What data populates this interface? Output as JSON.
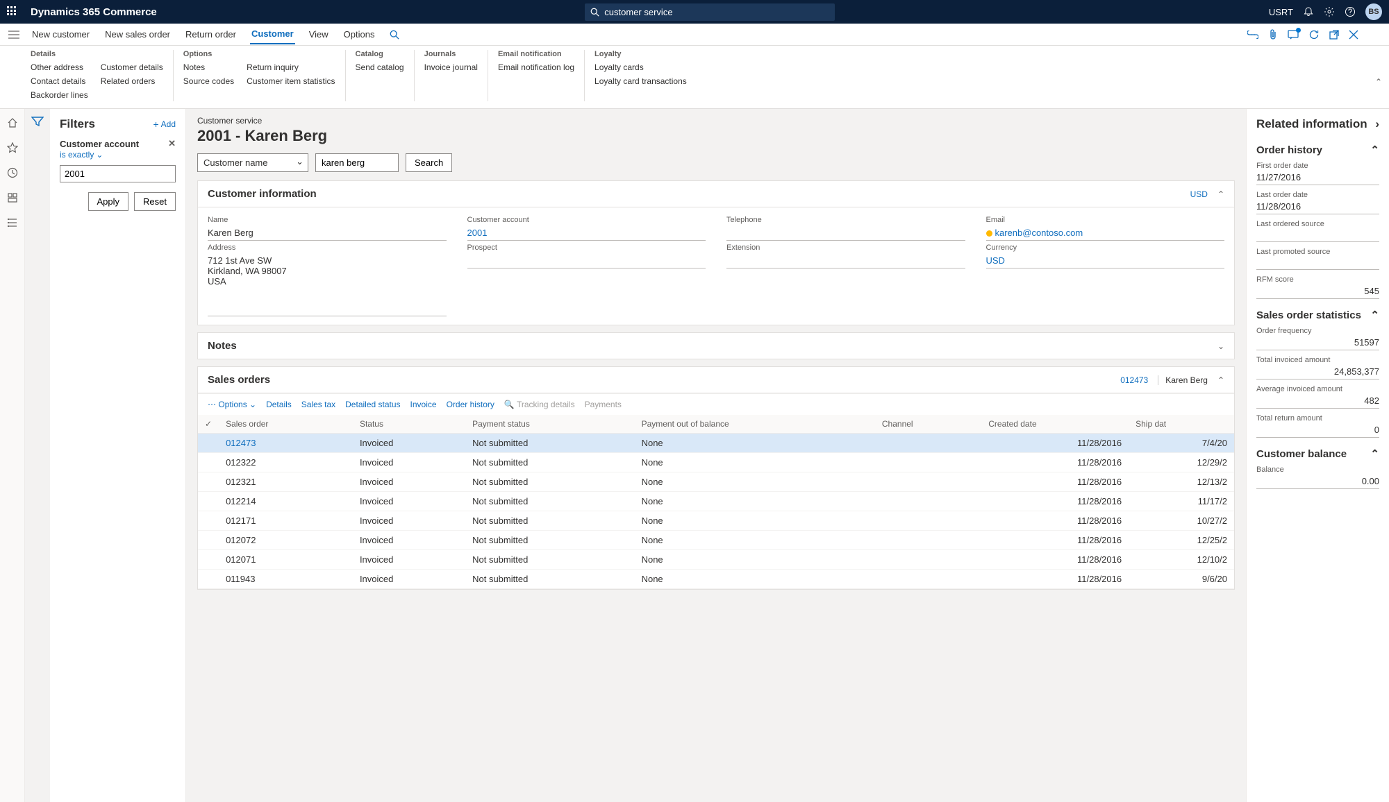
{
  "app": {
    "title": "Dynamics 365 Commerce",
    "search_value": "customer service",
    "company": "USRT",
    "avatar_initials": "BS"
  },
  "action_bar": {
    "items": [
      "New customer",
      "New sales order",
      "Return order",
      "Customer",
      "View",
      "Options"
    ]
  },
  "ribbon": {
    "groups": [
      {
        "title": "Details",
        "cols": [
          [
            "Other address",
            "Contact details",
            "Backorder lines"
          ],
          [
            "Customer details",
            "Related orders"
          ]
        ]
      },
      {
        "title": "Options",
        "cols": [
          [
            "Notes",
            "Source codes"
          ],
          [
            "Return inquiry",
            "Customer item statistics"
          ]
        ]
      },
      {
        "title": "Catalog",
        "cols": [
          [
            "Send catalog"
          ]
        ]
      },
      {
        "title": "Journals",
        "cols": [
          [
            "Invoice journal"
          ]
        ]
      },
      {
        "title": "Email notification",
        "cols": [
          [
            "Email notification log"
          ]
        ]
      },
      {
        "title": "Loyalty",
        "cols": [
          [
            "Loyalty cards",
            "Loyalty card transactions"
          ]
        ]
      }
    ]
  },
  "filters": {
    "title": "Filters",
    "add": "Add",
    "field_label": "Customer account",
    "operator": "is exactly",
    "value": "2001",
    "apply": "Apply",
    "reset": "Reset"
  },
  "page": {
    "breadcrumb": "Customer service",
    "title": "2001 - Karen Berg",
    "search_by": "Customer name",
    "search_value": "karen berg",
    "search_btn": "Search"
  },
  "customer_info": {
    "title": "Customer information",
    "currency_badge": "USD",
    "fields": {
      "name_label": "Name",
      "name": "Karen Berg",
      "account_label": "Customer account",
      "account": "2001",
      "telephone_label": "Telephone",
      "telephone": "",
      "email_label": "Email",
      "email": "karenb@contoso.com",
      "address_label": "Address",
      "address_line1": "712 1st Ave SW",
      "address_line2": "Kirkland, WA 98007",
      "address_line3": "USA",
      "prospect_label": "Prospect",
      "prospect": "",
      "extension_label": "Extension",
      "extension": "",
      "currency_label": "Currency",
      "currency": "USD"
    }
  },
  "notes": {
    "title": "Notes"
  },
  "sales_orders": {
    "title": "Sales orders",
    "current_id": "012473",
    "current_name": "Karen Berg",
    "toolbar": {
      "options": "Options",
      "details": "Details",
      "sales_tax": "Sales tax",
      "detailed_status": "Detailed status",
      "invoice": "Invoice",
      "order_history": "Order history",
      "tracking": "Tracking details",
      "payments": "Payments"
    },
    "columns": [
      "Sales order",
      "Status",
      "Payment status",
      "Payment out of balance",
      "Channel",
      "Created date",
      "Ship dat"
    ],
    "rows": [
      {
        "id": "012473",
        "status": "Invoiced",
        "pay": "Not submitted",
        "oob": "None",
        "channel": "",
        "created": "11/28/2016",
        "ship": "7/4/20"
      },
      {
        "id": "012322",
        "status": "Invoiced",
        "pay": "Not submitted",
        "oob": "None",
        "channel": "",
        "created": "11/28/2016",
        "ship": "12/29/2"
      },
      {
        "id": "012321",
        "status": "Invoiced",
        "pay": "Not submitted",
        "oob": "None",
        "channel": "",
        "created": "11/28/2016",
        "ship": "12/13/2"
      },
      {
        "id": "012214",
        "status": "Invoiced",
        "pay": "Not submitted",
        "oob": "None",
        "channel": "",
        "created": "11/28/2016",
        "ship": "11/17/2"
      },
      {
        "id": "012171",
        "status": "Invoiced",
        "pay": "Not submitted",
        "oob": "None",
        "channel": "",
        "created": "11/28/2016",
        "ship": "10/27/2"
      },
      {
        "id": "012072",
        "status": "Invoiced",
        "pay": "Not submitted",
        "oob": "None",
        "channel": "",
        "created": "11/28/2016",
        "ship": "12/25/2"
      },
      {
        "id": "012071",
        "status": "Invoiced",
        "pay": "Not submitted",
        "oob": "None",
        "channel": "",
        "created": "11/28/2016",
        "ship": "12/10/2"
      },
      {
        "id": "011943",
        "status": "Invoiced",
        "pay": "Not submitted",
        "oob": "None",
        "channel": "",
        "created": "11/28/2016",
        "ship": "9/6/20"
      }
    ]
  },
  "related": {
    "title": "Related information",
    "order_history": {
      "title": "Order history",
      "first_label": "First order date",
      "first": "11/27/2016",
      "last_label": "Last order date",
      "last": "11/28/2016",
      "ordered_src_label": "Last ordered source",
      "ordered_src": "",
      "promoted_src_label": "Last promoted source",
      "promoted_src": "",
      "rfm_label": "RFM score",
      "rfm": "545"
    },
    "stats": {
      "title": "Sales order statistics",
      "freq_label": "Order frequency",
      "freq": "51597",
      "inv_label": "Total invoiced amount",
      "inv": "24,853,377",
      "avg_label": "Average invoiced amount",
      "avg": "482",
      "ret_label": "Total return amount",
      "ret": "0"
    },
    "balance": {
      "title": "Customer balance",
      "bal_label": "Balance",
      "bal": "0.00"
    }
  }
}
